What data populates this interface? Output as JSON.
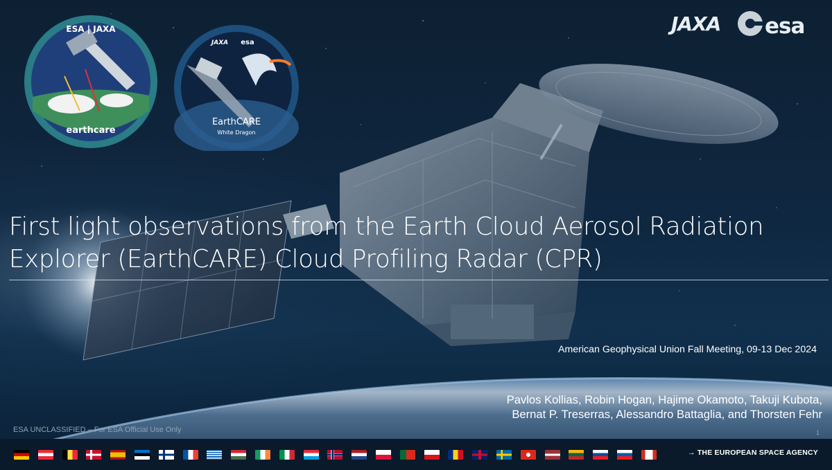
{
  "slide": {
    "title_line1": "First light observations from the Earth Cloud Aerosol Radiation",
    "title_line2": "Explorer (EarthCARE) Cloud Profiling Radar (CPR)",
    "meeting": "American Geophysical Union Fall Meeting, 09-13 Dec 2024",
    "authors_line1": "Pavlos Kollias, Robin Hogan, Hajime Okamoto, Takuji Kubota,",
    "authors_line2": "Bernat P. Treserras, Alessandro Battaglia, and Thorsten Fehr",
    "classification": "ESA UNCLASSIFIED – For ESA Official Use Only",
    "page_number": "1"
  },
  "logos": {
    "jaxa": "JAXA",
    "esa": "esa",
    "agency_tagline": "→ THE EUROPEAN SPACE AGENCY"
  },
  "patch_left": {
    "top_text": "ESA | JAXA",
    "bottom_text": "earthcare"
  },
  "patch_right": {
    "logo_left": "JAXA",
    "logo_right": "esa",
    "name": "EarthCARE",
    "subtitle": "White Dragon"
  },
  "colors": {
    "background": "#0f2740",
    "patch_left_ring": "#2a7c86",
    "patch_right_ring": "#1d4f7c",
    "footer": "#0a1a2a"
  },
  "flags": [
    "germany",
    "austria",
    "belgium",
    "denmark",
    "spain",
    "estonia",
    "finland",
    "france",
    "greece",
    "hungary",
    "ireland",
    "italy",
    "luxembourg",
    "norway",
    "netherlands",
    "poland",
    "portugal",
    "czechia",
    "romania",
    "united-kingdom",
    "sweden",
    "switzerland",
    "latvia",
    "lithuania",
    "slovakia",
    "slovenia",
    "canada"
  ]
}
